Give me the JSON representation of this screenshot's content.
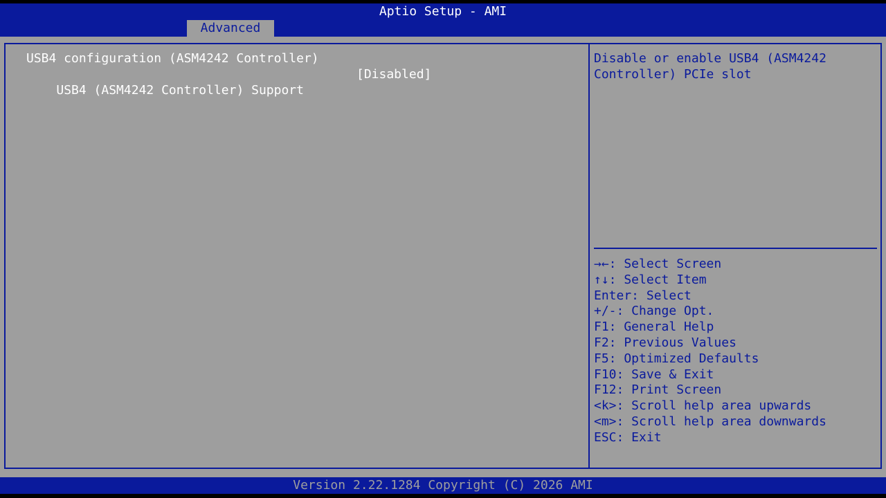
{
  "header": {
    "title": "Aptio Setup - AMI",
    "active_tab": "Advanced"
  },
  "menu": {
    "section_title": "USB4 configuration (ASM4242 Controller)",
    "items": [
      {
        "label": "USB4 (ASM4242 Controller) Support",
        "value": "[Disabled]"
      }
    ]
  },
  "help": {
    "description": "Disable or enable USB4 (ASM4242 Controller) PCIe slot"
  },
  "keys": [
    "→←: Select Screen",
    "↑↓: Select Item",
    "Enter: Select",
    "+/-: Change Opt.",
    "F1: General Help",
    "F2: Previous Values",
    "F5: Optimized Defaults",
    "F10: Save & Exit",
    "F12: Print Screen",
    "<k>: Scroll help area upwards",
    "<m>: Scroll help area downwards",
    "ESC: Exit"
  ],
  "footer": {
    "version": "Version 2.22.1284 Copyright (C) 2026 AMI"
  },
  "colors": {
    "bios_blue": "#0a1a9c",
    "panel_gray": "#9e9e9e",
    "text_white": "#ffffff"
  }
}
